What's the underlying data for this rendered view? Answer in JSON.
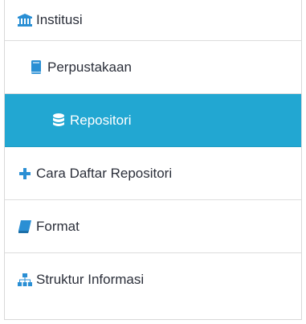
{
  "menu": {
    "items": [
      {
        "label": "Institusi",
        "icon": "institution-icon",
        "active": false
      },
      {
        "label": "Perpustakaan",
        "icon": "book-icon",
        "active": false
      },
      {
        "label": "Repositori",
        "icon": "database-icon",
        "active": true
      },
      {
        "label": "Cara Daftar Repositori",
        "icon": "plus-icon",
        "active": false
      },
      {
        "label": "Format",
        "icon": "book-icon",
        "active": false
      },
      {
        "label": "Struktur Informasi",
        "icon": "sitemap-icon",
        "active": false
      }
    ]
  },
  "colors": {
    "accent": "#22a7d2",
    "icon_blue": "#2a8fd4",
    "text": "#2b2f3a",
    "active_text": "#ffffff",
    "divider": "#dddddd"
  }
}
